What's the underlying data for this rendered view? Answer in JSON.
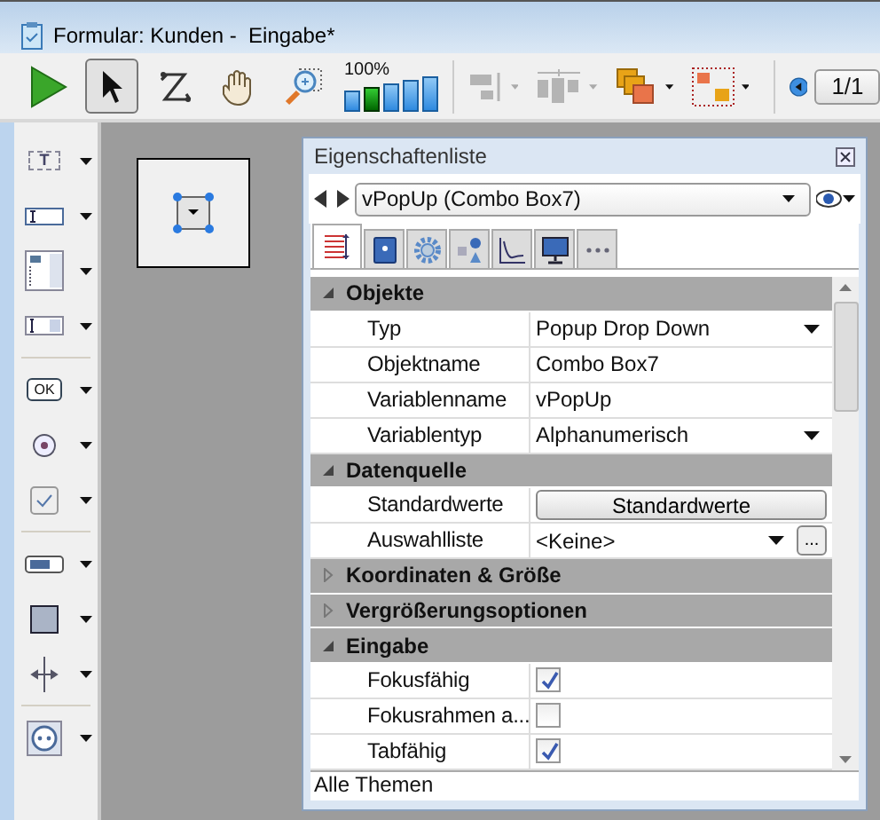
{
  "window": {
    "title": "Formular: Kunden -  Eingabe*"
  },
  "toolbar": {
    "tools": [
      {
        "kind": "run",
        "selected": false
      },
      {
        "kind": "pointer",
        "selected": true
      },
      {
        "kind": "z_order",
        "selected": false
      },
      {
        "kind": "hand",
        "selected": false
      },
      {
        "kind": "zoom",
        "selected": false
      }
    ],
    "zoom_label": "100%",
    "zoom_steps": [
      {
        "selected": false
      },
      {
        "selected": true
      },
      {
        "selected": false
      },
      {
        "selected": false
      },
      {
        "selected": false
      }
    ],
    "arrange_tools": [
      {
        "kind": "align",
        "disabled": true
      },
      {
        "kind": "distribute",
        "disabled": true
      },
      {
        "kind": "layers",
        "disabled": false
      },
      {
        "kind": "group",
        "disabled": false
      }
    ],
    "page": "1/1"
  },
  "tool_palette": [
    {
      "tools": [
        {
          "kind": "static_text",
          "label": "T"
        },
        {
          "kind": "input"
        },
        {
          "kind": "list"
        },
        {
          "kind": "combo"
        }
      ]
    },
    {
      "tools": [
        {
          "kind": "button",
          "label": "OK"
        },
        {
          "kind": "radio"
        },
        {
          "kind": "checkbox"
        }
      ]
    },
    {
      "tools": [
        {
          "kind": "meter"
        },
        {
          "kind": "rectangle"
        },
        {
          "kind": "splitter"
        }
      ]
    },
    {
      "tools": [
        {
          "kind": "plugin"
        }
      ]
    }
  ],
  "properties": {
    "title": "Eigenschaftenliste",
    "object_select": "vPopUp (Combo Box7)",
    "tabs": [
      {
        "kind": "list",
        "selected": true
      },
      {
        "kind": "book",
        "selected": false
      },
      {
        "kind": "gear",
        "selected": false
      },
      {
        "kind": "shapes",
        "selected": false
      },
      {
        "kind": "chart",
        "selected": false
      },
      {
        "kind": "monitor",
        "selected": false
      },
      {
        "kind": "more",
        "selected": false
      }
    ],
    "sections": [
      {
        "title": "Objekte",
        "expanded": true,
        "rows": [
          {
            "kind": "dropdown",
            "label": "Typ",
            "value": "Popup Drop Down"
          },
          {
            "kind": "text",
            "label": "Objektname",
            "value": "Combo Box7"
          },
          {
            "kind": "text",
            "label": "Variablenname",
            "value": "vPopUp"
          },
          {
            "kind": "dropdown",
            "label": "Variablentyp",
            "value": "Alphanumerisch"
          }
        ]
      },
      {
        "title": "Datenquelle",
        "expanded": true,
        "rows": [
          {
            "kind": "button",
            "label": "Standardwerte",
            "value": "Standardwerte"
          },
          {
            "kind": "dropdown_more",
            "label": "Auswahlliste",
            "value": "<Keine>",
            "more": "..."
          }
        ]
      },
      {
        "title": "Koordinaten & Größe",
        "expanded": false
      },
      {
        "title": "Vergrößerungsoptionen",
        "expanded": false
      },
      {
        "title": "Eingabe",
        "expanded": true,
        "rows": [
          {
            "kind": "checkbox",
            "label": "Fokusfähig",
            "checked": true
          },
          {
            "kind": "checkbox",
            "label": "Fokusrahmen a...",
            "checked": false
          },
          {
            "kind": "checkbox",
            "label": "Tabfähig",
            "checked": true
          }
        ]
      }
    ],
    "footer": "Alle Themen"
  }
}
